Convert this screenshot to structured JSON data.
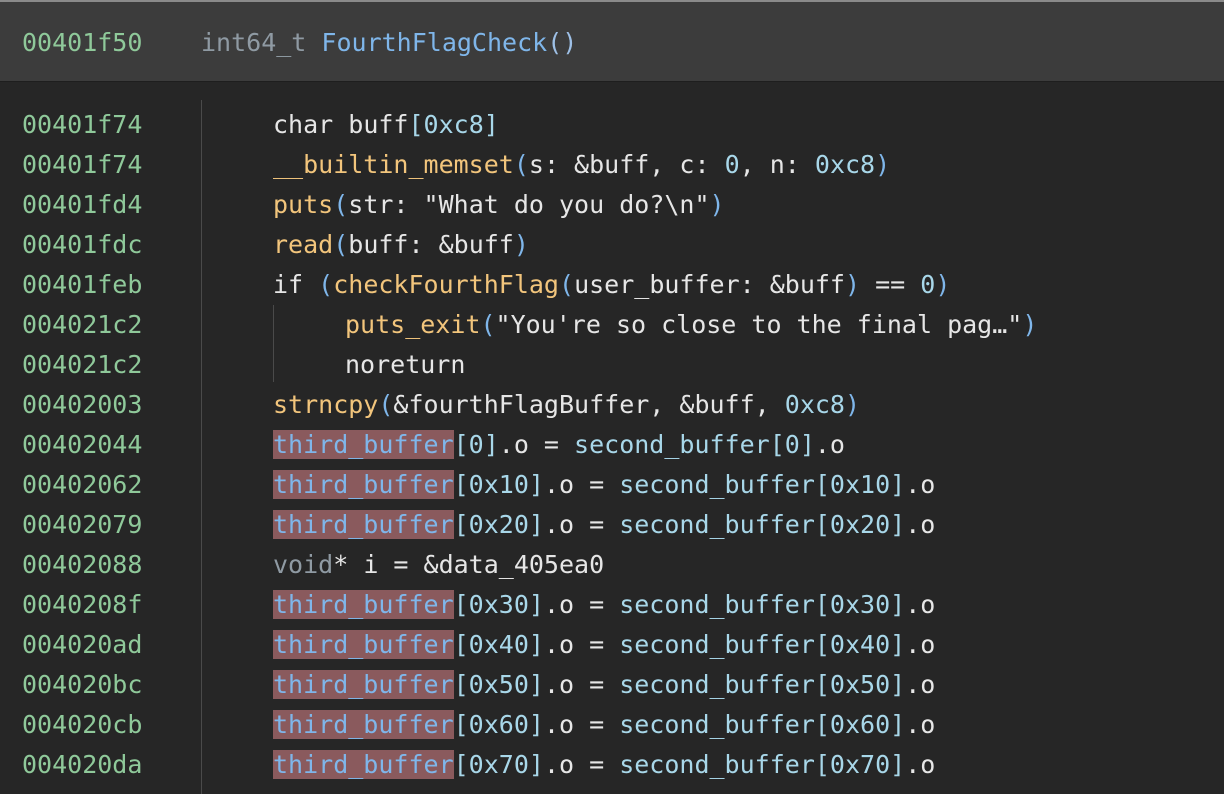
{
  "header": {
    "address": "00401f50",
    "return_type": "int64_t",
    "function_name": "FourthFlagCheck",
    "parens": "()"
  },
  "lines": [
    {
      "addr": "00401f74",
      "indent": 1,
      "parts": [
        {
          "c": "kw",
          "t": "char "
        },
        {
          "c": "var",
          "t": "buff"
        },
        {
          "c": "num",
          "t": "[0xc8]"
        }
      ]
    },
    {
      "addr": "00401f74",
      "indent": 1,
      "parts": [
        {
          "c": "call",
          "t": "__builtin_memset"
        },
        {
          "c": "paren",
          "t": "("
        },
        {
          "c": "param",
          "t": "s: &buff, c: "
        },
        {
          "c": "num",
          "t": "0"
        },
        {
          "c": "param",
          "t": ", n: "
        },
        {
          "c": "num",
          "t": "0xc8"
        },
        {
          "c": "paren",
          "t": ")"
        }
      ]
    },
    {
      "addr": "00401fd4",
      "indent": 1,
      "parts": [
        {
          "c": "call",
          "t": "puts"
        },
        {
          "c": "paren",
          "t": "("
        },
        {
          "c": "param",
          "t": "str: "
        },
        {
          "c": "str",
          "t": "\"What do you do?\\n\""
        },
        {
          "c": "paren",
          "t": ")"
        }
      ]
    },
    {
      "addr": "00401fdc",
      "indent": 1,
      "parts": [
        {
          "c": "call",
          "t": "read"
        },
        {
          "c": "paren",
          "t": "("
        },
        {
          "c": "param",
          "t": "buff: &buff"
        },
        {
          "c": "paren",
          "t": ")"
        }
      ]
    },
    {
      "addr": "00401feb",
      "indent": 1,
      "parts": [
        {
          "c": "kw",
          "t": "if "
        },
        {
          "c": "paren",
          "t": "("
        },
        {
          "c": "call",
          "t": "checkFourthFlag"
        },
        {
          "c": "paren",
          "t": "("
        },
        {
          "c": "param",
          "t": "user_buffer: &buff"
        },
        {
          "c": "paren",
          "t": ")"
        },
        {
          "c": "param",
          "t": " == "
        },
        {
          "c": "num",
          "t": "0"
        },
        {
          "c": "paren",
          "t": ")"
        }
      ]
    },
    {
      "addr": "004021c2",
      "indent": 2,
      "parts": [
        {
          "c": "call",
          "t": "puts_exit"
        },
        {
          "c": "paren",
          "t": "("
        },
        {
          "c": "str",
          "t": "\"You're so close to the final pag…\""
        },
        {
          "c": "paren",
          "t": ")"
        }
      ]
    },
    {
      "addr": "004021c2",
      "indent": 2,
      "parts": [
        {
          "c": "kw",
          "t": "noreturn"
        }
      ]
    },
    {
      "addr": "00402003",
      "indent": 1,
      "parts": [
        {
          "c": "call",
          "t": "strncpy"
        },
        {
          "c": "paren",
          "t": "("
        },
        {
          "c": "param",
          "t": "&fourthFlagBuffer, &buff, "
        },
        {
          "c": "num",
          "t": "0xc8"
        },
        {
          "c": "paren",
          "t": ")"
        }
      ]
    },
    {
      "addr": "00402044",
      "indent": 1,
      "parts": [
        {
          "c": "hl",
          "t": "third_buffer"
        },
        {
          "c": "num",
          "t": "[0]"
        },
        {
          "c": "var",
          "t": ".o = "
        },
        {
          "c": "tfield",
          "t": "second_buffer"
        },
        {
          "c": "num",
          "t": "[0]"
        },
        {
          "c": "var",
          "t": ".o"
        }
      ]
    },
    {
      "addr": "00402062",
      "indent": 1,
      "parts": [
        {
          "c": "hl",
          "t": "third_buffer"
        },
        {
          "c": "num",
          "t": "[0x10]"
        },
        {
          "c": "var",
          "t": ".o = "
        },
        {
          "c": "tfield",
          "t": "second_buffer"
        },
        {
          "c": "num",
          "t": "[0x10]"
        },
        {
          "c": "var",
          "t": ".o"
        }
      ]
    },
    {
      "addr": "00402079",
      "indent": 1,
      "parts": [
        {
          "c": "hl",
          "t": "third_buffer"
        },
        {
          "c": "num",
          "t": "[0x20]"
        },
        {
          "c": "var",
          "t": ".o = "
        },
        {
          "c": "tfield",
          "t": "second_buffer"
        },
        {
          "c": "num",
          "t": "[0x20]"
        },
        {
          "c": "var",
          "t": ".o"
        }
      ]
    },
    {
      "addr": "00402088",
      "indent": 1,
      "parts": [
        {
          "c": "ptype",
          "t": "void"
        },
        {
          "c": "var",
          "t": "* i = &data_405ea0"
        }
      ]
    },
    {
      "addr": "0040208f",
      "indent": 1,
      "parts": [
        {
          "c": "hl",
          "t": "third_buffer"
        },
        {
          "c": "num",
          "t": "[0x30]"
        },
        {
          "c": "var",
          "t": ".o = "
        },
        {
          "c": "tfield",
          "t": "second_buffer"
        },
        {
          "c": "num",
          "t": "[0x30]"
        },
        {
          "c": "var",
          "t": ".o"
        }
      ]
    },
    {
      "addr": "004020ad",
      "indent": 1,
      "parts": [
        {
          "c": "hl",
          "t": "third_buffer"
        },
        {
          "c": "num",
          "t": "[0x40]"
        },
        {
          "c": "var",
          "t": ".o = "
        },
        {
          "c": "tfield",
          "t": "second_buffer"
        },
        {
          "c": "num",
          "t": "[0x40]"
        },
        {
          "c": "var",
          "t": ".o"
        }
      ]
    },
    {
      "addr": "004020bc",
      "indent": 1,
      "parts": [
        {
          "c": "hl",
          "t": "third_buffer"
        },
        {
          "c": "num",
          "t": "[0x50]"
        },
        {
          "c": "var",
          "t": ".o = "
        },
        {
          "c": "tfield",
          "t": "second_buffer"
        },
        {
          "c": "num",
          "t": "[0x50]"
        },
        {
          "c": "var",
          "t": ".o"
        }
      ]
    },
    {
      "addr": "004020cb",
      "indent": 1,
      "parts": [
        {
          "c": "hl",
          "t": "third_buffer"
        },
        {
          "c": "num",
          "t": "[0x60]"
        },
        {
          "c": "var",
          "t": ".o = "
        },
        {
          "c": "tfield",
          "t": "second_buffer"
        },
        {
          "c": "num",
          "t": "[0x60]"
        },
        {
          "c": "var",
          "t": ".o"
        }
      ]
    },
    {
      "addr": "004020da",
      "indent": 1,
      "parts": [
        {
          "c": "hl",
          "t": "third_buffer"
        },
        {
          "c": "num",
          "t": "[0x70]"
        },
        {
          "c": "var",
          "t": ".o = "
        },
        {
          "c": "tfield",
          "t": "second_buffer"
        },
        {
          "c": "num",
          "t": "[0x70]"
        },
        {
          "c": "var",
          "t": ".o"
        }
      ]
    }
  ]
}
